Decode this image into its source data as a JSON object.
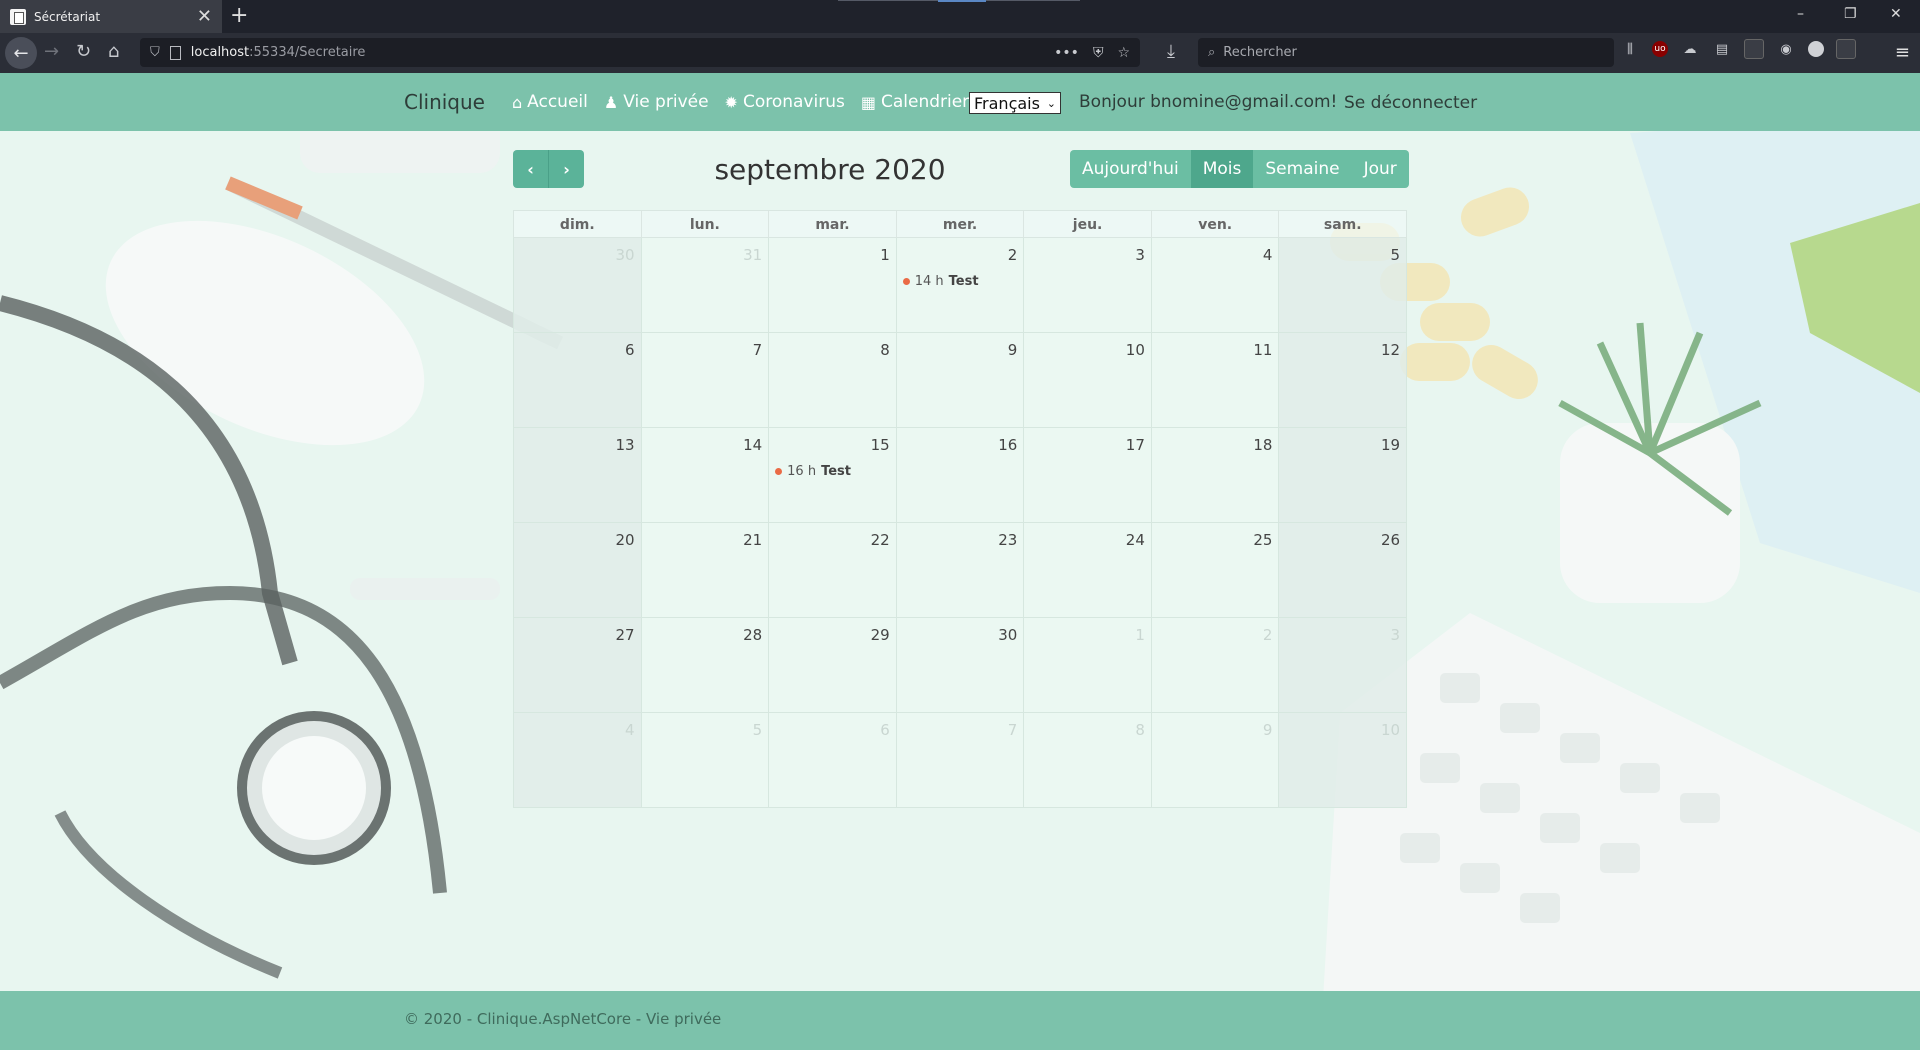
{
  "browser": {
    "tab_title": "Sécrétariat",
    "tab_close": "✕",
    "new_tab": "+",
    "url_host": "localhost",
    "url_path": ":55334/Secretaire",
    "search_placeholder": "Rechercher",
    "window_controls": [
      "–",
      "❐",
      "✕"
    ]
  },
  "header": {
    "brand": "Clinique",
    "menu": [
      {
        "icon": "home-icon",
        "glyph": "⌂",
        "label": "Accueil"
      },
      {
        "icon": "user-secret-icon",
        "glyph": "♟",
        "label": "Vie privée"
      },
      {
        "icon": "virus-icon",
        "glyph": "✹",
        "label": "Coronavirus"
      },
      {
        "icon": "calendar-icon",
        "glyph": "▦",
        "label": "Calendrier"
      }
    ],
    "language": "Français",
    "greeting": "Bonjour bnomine@gmail.com!",
    "logout": "Se déconnecter"
  },
  "calendar": {
    "title": "septembre 2020",
    "prev": "‹",
    "next": "›",
    "views": [
      "Aujourd'hui",
      "Mois",
      "Semaine",
      "Jour"
    ],
    "active_view": "Mois",
    "day_headers": [
      "dim.",
      "lun.",
      "mar.",
      "mer.",
      "jeu.",
      "ven.",
      "sam."
    ],
    "weeks": [
      [
        "30",
        "31",
        "1",
        "2",
        "3",
        "4",
        "5"
      ],
      [
        "6",
        "7",
        "8",
        "9",
        "10",
        "11",
        "12"
      ],
      [
        "13",
        "14",
        "15",
        "16",
        "17",
        "18",
        "19"
      ],
      [
        "20",
        "21",
        "22",
        "23",
        "24",
        "25",
        "26"
      ],
      [
        "27",
        "28",
        "29",
        "30",
        "1",
        "2",
        "3"
      ],
      [
        "4",
        "5",
        "6",
        "7",
        "8",
        "9",
        "10"
      ]
    ],
    "events": [
      {
        "week": 0,
        "day": 3,
        "time": "14 h",
        "title": "Test",
        "color": "#ea6b46"
      },
      {
        "week": 2,
        "day": 2,
        "time": "16 h",
        "title": "Test",
        "color": "#ea6b46"
      }
    ]
  },
  "footer": {
    "text": "© 2020 - Clinique.AspNetCore - Vie privée"
  },
  "colors": {
    "header_bg": "#7cc2ab",
    "button_bg": "#6bbea3",
    "button_active": "#4ea78c",
    "event_dot": "#ea6b46"
  }
}
